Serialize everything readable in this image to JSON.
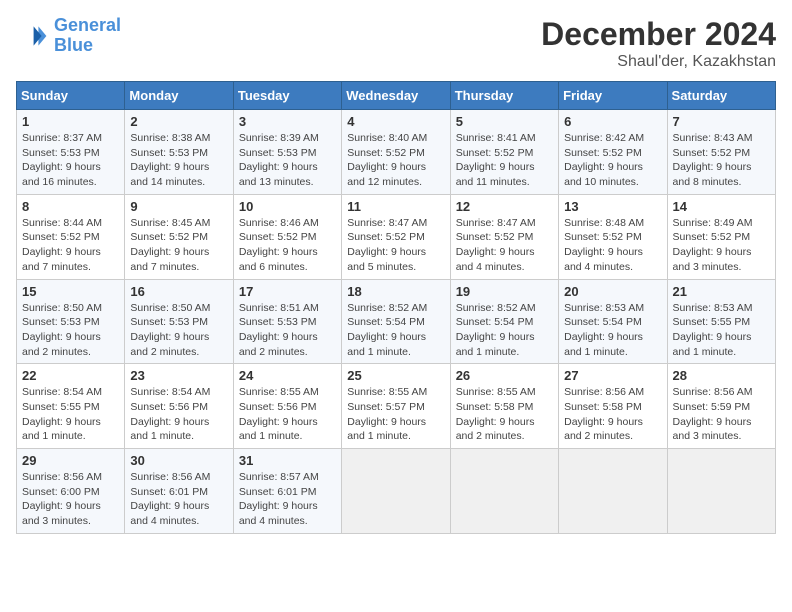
{
  "header": {
    "logo_line1": "General",
    "logo_line2": "Blue",
    "month": "December 2024",
    "location": "Shaul'der, Kazakhstan"
  },
  "weekdays": [
    "Sunday",
    "Monday",
    "Tuesday",
    "Wednesday",
    "Thursday",
    "Friday",
    "Saturday"
  ],
  "weeks": [
    [
      {
        "day": "1",
        "sunrise": "8:37 AM",
        "sunset": "5:53 PM",
        "daylight": "9 hours and 16 minutes."
      },
      {
        "day": "2",
        "sunrise": "8:38 AM",
        "sunset": "5:53 PM",
        "daylight": "9 hours and 14 minutes."
      },
      {
        "day": "3",
        "sunrise": "8:39 AM",
        "sunset": "5:53 PM",
        "daylight": "9 hours and 13 minutes."
      },
      {
        "day": "4",
        "sunrise": "8:40 AM",
        "sunset": "5:52 PM",
        "daylight": "9 hours and 12 minutes."
      },
      {
        "day": "5",
        "sunrise": "8:41 AM",
        "sunset": "5:52 PM",
        "daylight": "9 hours and 11 minutes."
      },
      {
        "day": "6",
        "sunrise": "8:42 AM",
        "sunset": "5:52 PM",
        "daylight": "9 hours and 10 minutes."
      },
      {
        "day": "7",
        "sunrise": "8:43 AM",
        "sunset": "5:52 PM",
        "daylight": "9 hours and 8 minutes."
      }
    ],
    [
      {
        "day": "8",
        "sunrise": "8:44 AM",
        "sunset": "5:52 PM",
        "daylight": "9 hours and 7 minutes."
      },
      {
        "day": "9",
        "sunrise": "8:45 AM",
        "sunset": "5:52 PM",
        "daylight": "9 hours and 7 minutes."
      },
      {
        "day": "10",
        "sunrise": "8:46 AM",
        "sunset": "5:52 PM",
        "daylight": "9 hours and 6 minutes."
      },
      {
        "day": "11",
        "sunrise": "8:47 AM",
        "sunset": "5:52 PM",
        "daylight": "9 hours and 5 minutes."
      },
      {
        "day": "12",
        "sunrise": "8:47 AM",
        "sunset": "5:52 PM",
        "daylight": "9 hours and 4 minutes."
      },
      {
        "day": "13",
        "sunrise": "8:48 AM",
        "sunset": "5:52 PM",
        "daylight": "9 hours and 4 minutes."
      },
      {
        "day": "14",
        "sunrise": "8:49 AM",
        "sunset": "5:52 PM",
        "daylight": "9 hours and 3 minutes."
      }
    ],
    [
      {
        "day": "15",
        "sunrise": "8:50 AM",
        "sunset": "5:53 PM",
        "daylight": "9 hours and 2 minutes."
      },
      {
        "day": "16",
        "sunrise": "8:50 AM",
        "sunset": "5:53 PM",
        "daylight": "9 hours and 2 minutes."
      },
      {
        "day": "17",
        "sunrise": "8:51 AM",
        "sunset": "5:53 PM",
        "daylight": "9 hours and 2 minutes."
      },
      {
        "day": "18",
        "sunrise": "8:52 AM",
        "sunset": "5:54 PM",
        "daylight": "9 hours and 1 minute."
      },
      {
        "day": "19",
        "sunrise": "8:52 AM",
        "sunset": "5:54 PM",
        "daylight": "9 hours and 1 minute."
      },
      {
        "day": "20",
        "sunrise": "8:53 AM",
        "sunset": "5:54 PM",
        "daylight": "9 hours and 1 minute."
      },
      {
        "day": "21",
        "sunrise": "8:53 AM",
        "sunset": "5:55 PM",
        "daylight": "9 hours and 1 minute."
      }
    ],
    [
      {
        "day": "22",
        "sunrise": "8:54 AM",
        "sunset": "5:55 PM",
        "daylight": "9 hours and 1 minute."
      },
      {
        "day": "23",
        "sunrise": "8:54 AM",
        "sunset": "5:56 PM",
        "daylight": "9 hours and 1 minute."
      },
      {
        "day": "24",
        "sunrise": "8:55 AM",
        "sunset": "5:56 PM",
        "daylight": "9 hours and 1 minute."
      },
      {
        "day": "25",
        "sunrise": "8:55 AM",
        "sunset": "5:57 PM",
        "daylight": "9 hours and 1 minute."
      },
      {
        "day": "26",
        "sunrise": "8:55 AM",
        "sunset": "5:58 PM",
        "daylight": "9 hours and 2 minutes."
      },
      {
        "day": "27",
        "sunrise": "8:56 AM",
        "sunset": "5:58 PM",
        "daylight": "9 hours and 2 minutes."
      },
      {
        "day": "28",
        "sunrise": "8:56 AM",
        "sunset": "5:59 PM",
        "daylight": "9 hours and 3 minutes."
      }
    ],
    [
      {
        "day": "29",
        "sunrise": "8:56 AM",
        "sunset": "6:00 PM",
        "daylight": "9 hours and 3 minutes."
      },
      {
        "day": "30",
        "sunrise": "8:56 AM",
        "sunset": "6:01 PM",
        "daylight": "9 hours and 4 minutes."
      },
      {
        "day": "31",
        "sunrise": "8:57 AM",
        "sunset": "6:01 PM",
        "daylight": "9 hours and 4 minutes."
      },
      null,
      null,
      null,
      null
    ]
  ]
}
